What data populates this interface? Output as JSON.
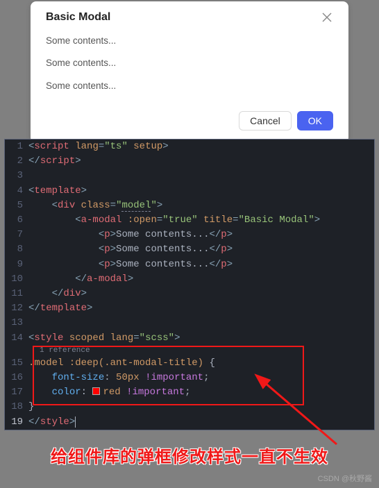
{
  "modal": {
    "title": "Basic Modal",
    "lines": [
      "Some contents...",
      "Some contents...",
      "Some contents..."
    ],
    "cancel": "Cancel",
    "ok": "OK"
  },
  "editor": {
    "ref_hint": "1 reference",
    "lines": [
      {
        "n": 1,
        "html": "<span class='tag-br'>&lt;</span><span class='tag-nm'>script</span> <span class='attr'>lang</span><span class='tag-br'>=</span><span class='str'>\"ts\"</span> <span class='attr'>setup</span><span class='tag-br'>&gt;</span>"
      },
      {
        "n": 2,
        "html": "<span class='tag-br'>&lt;/</span><span class='tag-nm'>script</span><span class='tag-br'>&gt;</span>"
      },
      {
        "n": 3,
        "html": ""
      },
      {
        "n": 4,
        "html": "<span class='tag-br'>&lt;</span><span class='tag-nm'>template</span><span class='tag-br'>&gt;</span>"
      },
      {
        "n": 5,
        "html": "    <span class='tag-br'>&lt;</span><span class='tag-nm'>div</span> <span class='attr'>class</span><span class='tag-br'>=</span><span class='str'>\"<span class='underline'>model</span>\"</span><span class='tag-br'>&gt;</span>"
      },
      {
        "n": 6,
        "html": "        <span class='tag-br'>&lt;</span><span class='tag-nm'>a-modal</span> <span class='attr'>:open</span><span class='tag-br'>=</span><span class='str'>\"true\"</span> <span class='attr'>title</span><span class='tag-br'>=</span><span class='str'>\"Basic Modal\"</span><span class='tag-br'>&gt;</span>"
      },
      {
        "n": 7,
        "html": "            <span class='tag-br'>&lt;</span><span class='tag-nm'>p</span><span class='tag-br'>&gt;</span><span class='txt'>Some contents...</span><span class='tag-br'>&lt;/</span><span class='tag-nm'>p</span><span class='tag-br'>&gt;</span>"
      },
      {
        "n": 8,
        "html": "            <span class='tag-br'>&lt;</span><span class='tag-nm'>p</span><span class='tag-br'>&gt;</span><span class='txt'>Some contents...</span><span class='tag-br'>&lt;/</span><span class='tag-nm'>p</span><span class='tag-br'>&gt;</span>"
      },
      {
        "n": 9,
        "html": "            <span class='tag-br'>&lt;</span><span class='tag-nm'>p</span><span class='tag-br'>&gt;</span><span class='txt'>Some contents...</span><span class='tag-br'>&lt;/</span><span class='tag-nm'>p</span><span class='tag-br'>&gt;</span>"
      },
      {
        "n": 10,
        "html": "        <span class='tag-br'>&lt;/</span><span class='tag-nm'>a-modal</span><span class='tag-br'>&gt;</span>"
      },
      {
        "n": 11,
        "html": "    <span class='tag-br'>&lt;/</span><span class='tag-nm'>div</span><span class='tag-br'>&gt;</span>"
      },
      {
        "n": 12,
        "html": "<span class='tag-br'>&lt;/</span><span class='tag-nm'>template</span><span class='tag-br'>&gt;</span>"
      },
      {
        "n": 13,
        "html": ""
      },
      {
        "n": 14,
        "html": "<span class='tag-br'>&lt;</span><span class='tag-nm'>style</span> <span class='attr'>scoped</span> <span class='attr'>lang</span><span class='tag-br'>=</span><span class='str'>\"scss\"</span><span class='tag-br'>&gt;</span>"
      },
      {
        "n": 15,
        "html": "<span class='sel'>.model :deep(.ant-modal-title)</span> <span class='txt'>{</span>"
      },
      {
        "n": 16,
        "html": "    <span class='prop'>font-size</span><span class='txt'>: </span><span class='num'>50px</span> <span class='kw'>!important</span><span class='txt'>;</span>"
      },
      {
        "n": 17,
        "html": "    <span class='prop'>color</span><span class='txt'>: </span><span class='swatch'></span><span class='num'>red</span> <span class='kw'>!important</span><span class='txt'>;</span>"
      },
      {
        "n": 18,
        "html": "<span class='txt'>}</span>"
      },
      {
        "n": 19,
        "active": true,
        "html": "<span class='tag-br'>&lt;/</span><span class='tag-nm'>style</span><span class='tag-br'>&gt;</span><span class='cursor'></span>"
      }
    ]
  },
  "caption": "给组件库的弹框修改样式一直不生效",
  "watermark": "CSDN @秋野酱"
}
